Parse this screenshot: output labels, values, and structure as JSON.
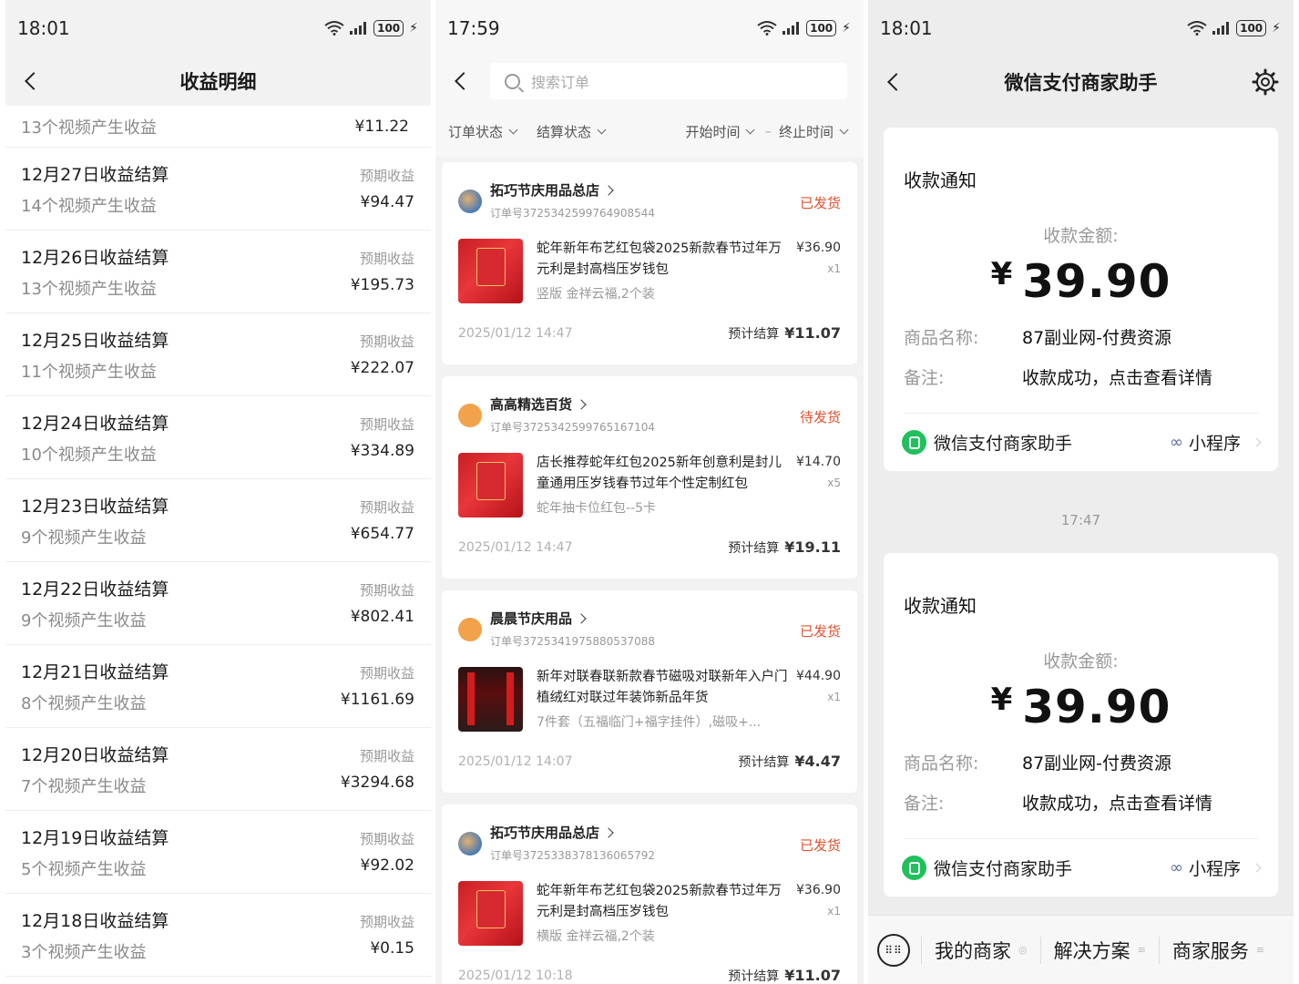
{
  "panel1": {
    "status": {
      "time": "18:01",
      "battery": "100"
    },
    "nav": {
      "title": "收益明细"
    },
    "top_row": {
      "subtitle": "13个视频产生收益",
      "amount": "¥11.22"
    },
    "rows": [
      {
        "title": "12月27日收益结算",
        "subtitle": "14个视频产生收益",
        "label": "预期收益",
        "amount": "¥94.47"
      },
      {
        "title": "12月26日收益结算",
        "subtitle": "13个视频产生收益",
        "label": "预期收益",
        "amount": "¥195.73"
      },
      {
        "title": "12月25日收益结算",
        "subtitle": "11个视频产生收益",
        "label": "预期收益",
        "amount": "¥222.07"
      },
      {
        "title": "12月24日收益结算",
        "subtitle": "10个视频产生收益",
        "label": "预期收益",
        "amount": "¥334.89"
      },
      {
        "title": "12月23日收益结算",
        "subtitle": "9个视频产生收益",
        "label": "预期收益",
        "amount": "¥654.77"
      },
      {
        "title": "12月22日收益结算",
        "subtitle": "9个视频产生收益",
        "label": "预期收益",
        "amount": "¥802.41"
      },
      {
        "title": "12月21日收益结算",
        "subtitle": "8个视频产生收益",
        "label": "预期收益",
        "amount": "¥1161.69"
      },
      {
        "title": "12月20日收益结算",
        "subtitle": "7个视频产生收益",
        "label": "预期收益",
        "amount": "¥3294.68"
      },
      {
        "title": "12月19日收益结算",
        "subtitle": "5个视频产生收益",
        "label": "预期收益",
        "amount": "¥92.02"
      },
      {
        "title": "12月18日收益结算",
        "subtitle": "3个视频产生收益",
        "label": "预期收益",
        "amount": "¥0.15"
      }
    ]
  },
  "panel2": {
    "status": {
      "time": "17:59",
      "battery": "100"
    },
    "search": {
      "placeholder": "搜索订单"
    },
    "filters": {
      "order_status": "订单状态",
      "settle_status": "结算状态",
      "start_time": "开始时间",
      "dash": "–",
      "end_time": "终止时间"
    },
    "orders": [
      {
        "shop": "拓巧节庆用品总店",
        "order_no": "订单号3725342599764908544",
        "status": "已发货",
        "title": "蛇年新年布艺红包袋2025新款春节过年万元利是封高档压岁钱包",
        "spec": "竖版 金祥云福,2个装",
        "price": "¥36.90",
        "qty": "x1",
        "time": "2025/01/12 14:47",
        "settle_label": "预计结算",
        "settle_amount": "¥11.07"
      },
      {
        "shop": "高高精选百货",
        "order_no": "订单号3725342599765167104",
        "status": "待发货",
        "title": "店长推荐蛇年红包2025新年创意利是封儿童通用压岁钱春节过年个性定制红包",
        "spec": "蛇年抽卡位红包--5卡",
        "price": "¥14.70",
        "qty": "x5",
        "time": "2025/01/12 14:47",
        "settle_label": "预计结算",
        "settle_amount": "¥19.11"
      },
      {
        "shop": "晨晨节庆用品",
        "order_no": "订单号3725341975880537088",
        "status": "已发货",
        "title": "新年对联春联新款春节磁吸对联新年入户门植绒红对联过年装饰新品年货",
        "spec": "7件套（五福临门+福字挂件）,磁吸+...",
        "price": "¥44.90",
        "qty": "x1",
        "time": "2025/01/12 14:07",
        "settle_label": "预计结算",
        "settle_amount": "¥4.47"
      },
      {
        "shop": "拓巧节庆用品总店",
        "order_no": "订单号3725338378136065792",
        "status": "已发货",
        "title": "蛇年新年布艺红包袋2025新款春节过年万元利是封高档压岁钱包",
        "spec": "横版 金祥云福,2个装",
        "price": "¥36.90",
        "qty": "x1",
        "time": "2025/01/12 10:18",
        "settle_label": "预计结算",
        "settle_amount": "¥11.07"
      }
    ]
  },
  "panel3": {
    "status": {
      "time": "18:01",
      "battery": "100"
    },
    "nav": {
      "title": "微信支付商家助手"
    },
    "cards": [
      {
        "title": "收款通知",
        "amount_label": "收款金额:",
        "currency": "¥",
        "amount": "39.90",
        "product_key": "商品名称:",
        "product_val": "87副业网-付费资源",
        "note_key": "备注:",
        "note_val": "收款成功，点击查看详情",
        "app_name": "微信支付商家助手",
        "mini_label": "小程序"
      },
      {
        "title": "收款通知",
        "amount_label": "收款金额:",
        "currency": "¥",
        "amount": "39.90",
        "product_key": "商品名称:",
        "product_val": "87副业网-付费资源",
        "note_key": "备注:",
        "note_val": "收款成功，点击查看详情",
        "app_name": "微信支付商家助手",
        "mini_label": "小程序"
      }
    ],
    "time_divider": "17:47",
    "bottom": {
      "item1": "我的商家",
      "item2": "解决方案",
      "item3": "商家服务"
    }
  }
}
